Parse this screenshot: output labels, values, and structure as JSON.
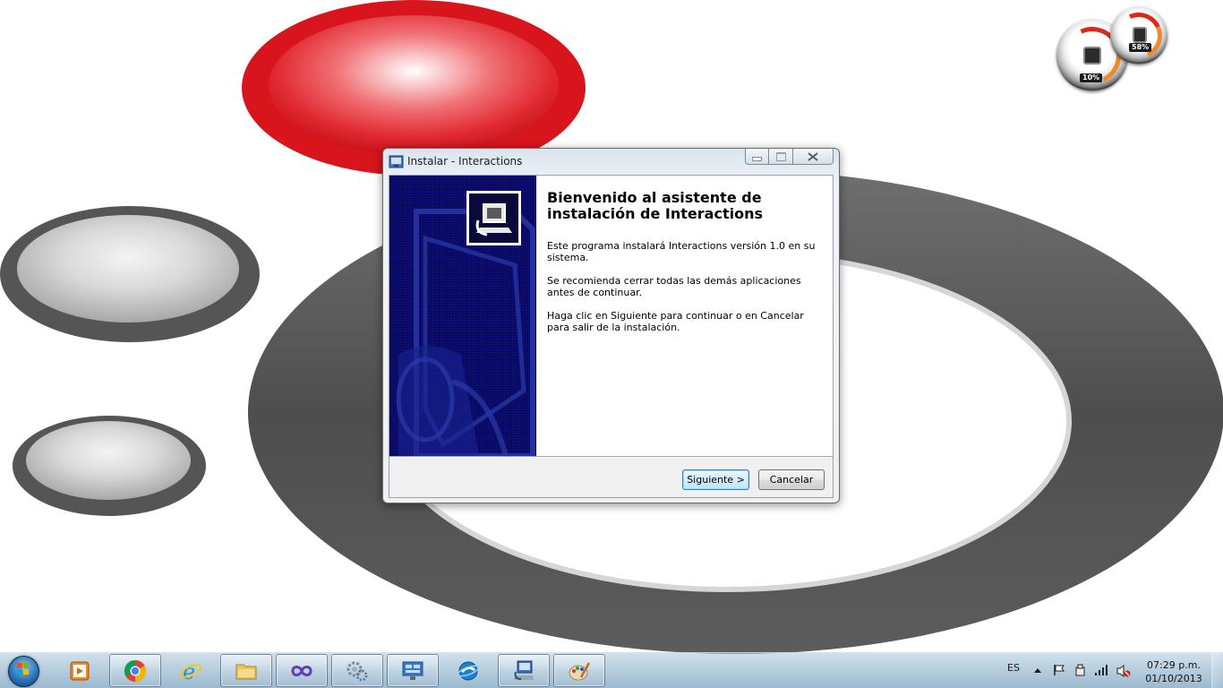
{
  "window": {
    "title": "Instalar - Interactions",
    "heading": "Bienvenido al asistente de instalación de Interactions",
    "paragraphs": [
      "Este programa instalará Interactions versión 1.0 en su sistema.",
      "Se recomienda cerrar todas las demás aplicaciones antes de continuar.",
      "Haga clic en Siguiente para continuar o en Cancelar para salir de la instalación."
    ],
    "buttons": {
      "next": "Siguiente >",
      "cancel": "Cancelar"
    }
  },
  "gadget": {
    "cpu_percent": "10%",
    "memory_percent": "58%"
  },
  "taskbar": {
    "pinned": [
      {
        "icon": "media-player-icon",
        "active": false
      },
      {
        "icon": "chrome-icon",
        "active": true
      },
      {
        "icon": "internet-explorer-icon",
        "active": false
      },
      {
        "icon": "file-explorer-icon",
        "active": true
      },
      {
        "icon": "visual-studio-icon",
        "active": true
      },
      {
        "icon": "settings-gears-icon",
        "active": true
      },
      {
        "icon": "control-panel-icon",
        "active": true
      },
      {
        "icon": "internet-browser-icon",
        "active": false
      },
      {
        "icon": "setup-installer-icon",
        "active": true
      },
      {
        "icon": "paint-icon",
        "active": true
      }
    ],
    "tray": {
      "language": "ES",
      "time": "07:29 p.m.",
      "date": "01/10/2013"
    }
  },
  "colors": {
    "banner": "#0c0c7a",
    "desktop_red": "#d8141c",
    "desktop_gray": "#5e5e5e"
  }
}
